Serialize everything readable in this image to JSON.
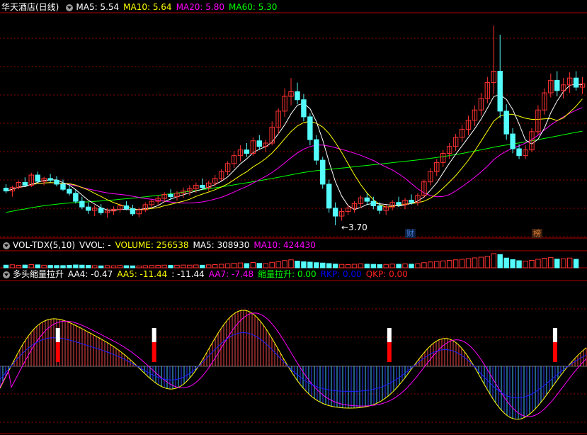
{
  "main": {
    "title": "华天酒店(日线)",
    "ma_labels": [
      {
        "text": "MA5: 5.54",
        "color": "#ffffff"
      },
      {
        "text": "MA10: 5.64",
        "color": "#ffff00"
      },
      {
        "text": "MA20: 5.80",
        "color": "#ff00ff"
      },
      {
        "text": "MA60: 5.30",
        "color": "#00ff00"
      }
    ],
    "low_mark": "←3.70",
    "badges": [
      {
        "text": "财",
        "color": "#3b7ddd"
      },
      {
        "text": "榜",
        "color": "#e08030"
      }
    ]
  },
  "volume": {
    "title": "VOL-TDX(5,10)",
    "labels": [
      {
        "text": "VVOL: -",
        "color": "#ffffff"
      },
      {
        "text": "VOLUME: 256538",
        "color": "#ffff00"
      },
      {
        "text": "MA5: 308930",
        "color": "#ffffff"
      },
      {
        "text": "MA10: 424430",
        "color": "#ff00ff"
      }
    ]
  },
  "indicator": {
    "title": "多头缩量拉升",
    "labels": [
      {
        "text": "AA4: -0.47",
        "color": "#ffffff"
      },
      {
        "text": "AA5: -11.44",
        "color": "#ffff00"
      },
      {
        "text": ": -11.44",
        "color": "#ffffff"
      },
      {
        "text": "AA7: -7.48",
        "color": "#ff00ff"
      },
      {
        "text": "缩量拉升: 0.00",
        "color": "#00ff00"
      },
      {
        "text": "RKP: 0.00",
        "color": "#0000ff"
      },
      {
        "text": "QKP: 0.00",
        "color": "#ff2020"
      }
    ]
  },
  "colors": {
    "up": "#ff3232",
    "down": "#54fcfc",
    "ma5": "#ffffff",
    "ma10": "#ffff00",
    "ma20": "#ff00ff",
    "ma60": "#00ff00",
    "grid": "#8b0000",
    "frame": "#b00000"
  },
  "chart_data": {
    "type": "line",
    "last_values": {
      "MA5": 5.54,
      "MA10": 5.64,
      "MA20": 5.8,
      "MA60": 5.3,
      "VOLUME": 256538,
      "VOL_MA5": 308930,
      "VOL_MA10": 424430
    },
    "lowest_price": 3.7,
    "candles": [
      [
        4.35,
        4.42,
        4.26,
        4.3
      ],
      [
        4.3,
        4.39,
        4.2,
        4.36
      ],
      [
        4.36,
        4.48,
        4.33,
        4.45
      ],
      [
        4.45,
        4.54,
        4.38,
        4.4
      ],
      [
        4.4,
        4.62,
        4.37,
        4.58
      ],
      [
        4.58,
        4.64,
        4.44,
        4.47
      ],
      [
        4.47,
        4.55,
        4.4,
        4.52
      ],
      [
        4.52,
        4.6,
        4.45,
        4.49
      ],
      [
        4.49,
        4.56,
        4.38,
        4.42
      ],
      [
        4.42,
        4.5,
        4.3,
        4.33
      ],
      [
        4.33,
        4.41,
        4.22,
        4.26
      ],
      [
        4.26,
        4.32,
        4.08,
        4.12
      ],
      [
        4.12,
        4.2,
        3.98,
        4.02
      ],
      [
        4.02,
        4.1,
        3.9,
        3.96
      ],
      [
        3.96,
        4.05,
        3.86,
        4.0
      ],
      [
        4.0,
        4.07,
        3.88,
        3.92
      ],
      [
        3.92,
        4.0,
        3.83,
        3.95
      ],
      [
        3.95,
        4.03,
        3.88,
        3.98
      ],
      [
        3.98,
        4.08,
        3.92,
        4.04
      ],
      [
        4.04,
        4.12,
        3.96,
        3.99
      ],
      [
        3.99,
        4.06,
        3.86,
        3.9
      ],
      [
        3.9,
        4.01,
        3.84,
        3.97
      ],
      [
        3.97,
        4.1,
        3.93,
        4.06
      ],
      [
        4.06,
        4.15,
        4.0,
        4.12
      ],
      [
        4.12,
        4.22,
        4.06,
        4.17
      ],
      [
        4.17,
        4.28,
        4.1,
        4.24
      ],
      [
        4.24,
        4.33,
        4.15,
        4.2
      ],
      [
        4.2,
        4.3,
        4.13,
        4.26
      ],
      [
        4.26,
        4.36,
        4.18,
        4.3
      ],
      [
        4.3,
        4.4,
        4.22,
        4.34
      ],
      [
        4.34,
        4.45,
        4.27,
        4.4
      ],
      [
        4.4,
        4.52,
        4.33,
        4.36
      ],
      [
        4.36,
        4.48,
        4.3,
        4.44
      ],
      [
        4.44,
        4.58,
        4.38,
        4.52
      ],
      [
        4.52,
        4.68,
        4.48,
        4.64
      ],
      [
        4.64,
        4.82,
        4.58,
        4.78
      ],
      [
        4.78,
        5.0,
        4.7,
        4.92
      ],
      [
        4.92,
        5.1,
        4.82,
        5.02
      ],
      [
        5.02,
        5.14,
        4.9,
        4.96
      ],
      [
        4.96,
        5.24,
        4.92,
        5.18
      ],
      [
        5.18,
        5.28,
        5.02,
        5.08
      ],
      [
        5.08,
        5.2,
        4.98,
        5.14
      ],
      [
        5.14,
        5.52,
        5.1,
        5.42
      ],
      [
        5.42,
        5.75,
        5.3,
        5.7
      ],
      [
        5.7,
        6.1,
        5.6,
        5.96
      ],
      [
        5.96,
        6.28,
        5.8,
        6.04
      ],
      [
        6.04,
        6.2,
        5.82,
        5.9
      ],
      [
        5.9,
        6.0,
        5.52,
        5.6
      ],
      [
        5.6,
        5.66,
        5.1,
        5.2
      ],
      [
        5.2,
        5.28,
        4.76,
        4.84
      ],
      [
        4.84,
        4.9,
        4.34,
        4.42
      ],
      [
        4.42,
        4.5,
        3.92,
        4.0
      ],
      [
        4.0,
        4.1,
        3.7,
        3.86
      ],
      [
        3.86,
        4.0,
        3.78,
        3.94
      ],
      [
        3.94,
        4.06,
        3.88,
        4.0
      ],
      [
        4.0,
        4.12,
        3.92,
        4.08
      ],
      [
        4.08,
        4.22,
        4.0,
        4.18
      ],
      [
        4.18,
        4.26,
        4.06,
        4.12
      ],
      [
        4.12,
        4.2,
        3.98,
        4.04
      ],
      [
        4.04,
        4.1,
        3.9,
        3.96
      ],
      [
        3.96,
        4.06,
        3.88,
        4.02
      ],
      [
        4.02,
        4.14,
        3.96,
        4.1
      ],
      [
        4.1,
        4.2,
        4.02,
        4.06
      ],
      [
        4.06,
        4.18,
        3.98,
        4.14
      ],
      [
        4.14,
        4.24,
        4.06,
        4.1
      ],
      [
        4.1,
        4.26,
        4.04,
        4.22
      ],
      [
        4.22,
        4.5,
        4.18,
        4.46
      ],
      [
        4.46,
        4.7,
        4.4,
        4.64
      ],
      [
        4.64,
        4.86,
        4.56,
        4.8
      ],
      [
        4.8,
        5.02,
        4.72,
        4.96
      ],
      [
        4.96,
        5.14,
        4.86,
        5.08
      ],
      [
        5.08,
        5.3,
        5.0,
        5.24
      ],
      [
        5.24,
        5.46,
        5.16,
        5.38
      ],
      [
        5.38,
        5.62,
        5.28,
        5.54
      ],
      [
        5.54,
        5.8,
        5.44,
        5.72
      ],
      [
        5.72,
        6.02,
        5.62,
        5.92
      ],
      [
        5.92,
        6.3,
        5.84,
        6.2
      ],
      [
        6.2,
        7.2,
        6.0,
        6.4
      ],
      [
        6.4,
        7.04,
        5.58,
        5.7
      ],
      [
        5.7,
        5.82,
        5.2,
        5.3
      ],
      [
        5.3,
        5.4,
        4.96,
        5.04
      ],
      [
        5.04,
        5.12,
        4.86,
        4.92
      ],
      [
        4.92,
        5.1,
        4.86,
        5.02
      ],
      [
        5.02,
        5.4,
        4.98,
        5.34
      ],
      [
        5.34,
        5.8,
        5.28,
        5.72
      ],
      [
        5.72,
        6.1,
        5.64,
        6.02
      ],
      [
        6.02,
        6.36,
        5.94,
        6.24
      ],
      [
        6.24,
        6.4,
        5.96,
        6.06
      ],
      [
        6.06,
        6.28,
        5.92,
        6.16
      ],
      [
        6.16,
        6.38,
        6.02,
        6.28
      ],
      [
        6.28,
        6.4,
        6.06,
        6.12
      ],
      [
        6.12,
        6.3,
        6.0,
        6.18
      ]
    ],
    "volume": [
      30,
      34,
      28,
      31,
      36,
      33,
      29,
      27,
      26,
      25,
      28,
      32,
      30,
      27,
      24,
      22,
      25,
      23,
      26,
      24,
      22,
      21,
      24,
      26,
      28,
      30,
      27,
      29,
      31,
      30,
      32,
      29,
      33,
      36,
      40,
      45,
      52,
      55,
      48,
      60,
      50,
      47,
      62,
      70,
      82,
      90,
      76,
      68,
      64,
      58,
      54,
      48,
      42,
      38,
      36,
      40,
      44,
      41,
      39,
      36,
      38,
      42,
      40,
      44,
      41,
      46,
      58,
      66,
      72,
      78,
      84,
      90,
      96,
      104,
      112,
      120,
      130,
      160,
      150,
      110,
      92,
      80,
      76,
      84,
      96,
      108,
      115,
      98,
      102,
      110,
      96
    ],
    "indicator_marks_x_index": [
      5,
      23,
      67,
      98
    ]
  }
}
